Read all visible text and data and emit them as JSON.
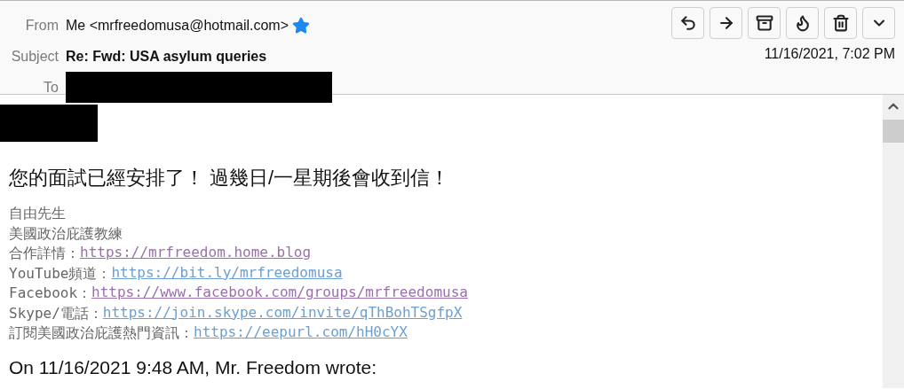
{
  "header": {
    "from_label": "From",
    "from": "Me <mrfreedomusa@hotmail.com>",
    "starred": true,
    "subject_label": "Subject",
    "subject": "Re: Fwd: USA asylum queries",
    "to_label": "To",
    "to_redacted": true,
    "date": "11/16/2021, 7:02 PM",
    "actions": [
      {
        "kind": "reply"
      },
      {
        "kind": "forward"
      },
      {
        "kind": "archive"
      },
      {
        "kind": "junk"
      },
      {
        "kind": "delete"
      },
      {
        "kind": "more"
      }
    ]
  },
  "body": {
    "sender_redacted": true,
    "heading": "您的面試已經安排了！ 過幾日/一星期後會收到信！",
    "signature": [
      {
        "label": "自由先生"
      },
      {
        "label": "美國政治庇護教練"
      },
      {
        "label": "合作詳情：",
        "link": "https://mrfreedom.home.blog",
        "visited": true
      },
      {
        "label": "YouTube頻道：",
        "link": "https://bit.ly/mrfreedomusa",
        "visited": false
      },
      {
        "label": "Facebook：",
        "link": "https://www.facebook.com/groups/mrfreedomusa",
        "visited": true
      },
      {
        "label": "Skype/電話：",
        "link": "https://join.skype.com/invite/qThBohTSgfpX",
        "visited": false
      },
      {
        "label": "訂閱美國政治庇護熱門資訊：",
        "link": "https://eepurl.com/hH0cYX",
        "visited": false
      }
    ],
    "quote_intro": "On 11/16/2021 9:48 AM, Mr. Freedom wrote:"
  }
}
